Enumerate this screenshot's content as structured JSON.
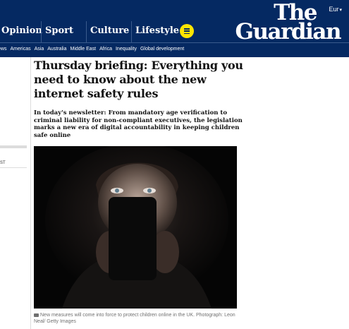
{
  "header": {
    "edition": "Eur",
    "logo_line1": "The",
    "logo_line2": "Guardian",
    "pillars": [
      "Opinion",
      "Sport",
      "Culture",
      "Lifestyle"
    ],
    "brand_color": "#052962",
    "menu_color": "#ffe500"
  },
  "subnav": [
    "ews",
    "Americas",
    "Asia",
    "Australia",
    "Middle East",
    "Africa",
    "Inequality",
    "Global development"
  ],
  "left": {
    "fragment": "ST"
  },
  "article": {
    "headline": "Thursday briefing: Everything you need to know about the new internet safety rules",
    "standfirst": "In today's newsletter: From mandatory age verification to criminal liability for non-compliant executives, the legislation marks a new era of digital accountability in keeping children safe online",
    "caption": "New measures will come into force to protect children online in the UK. Photograph: Leon Neal/ Getty Images"
  }
}
